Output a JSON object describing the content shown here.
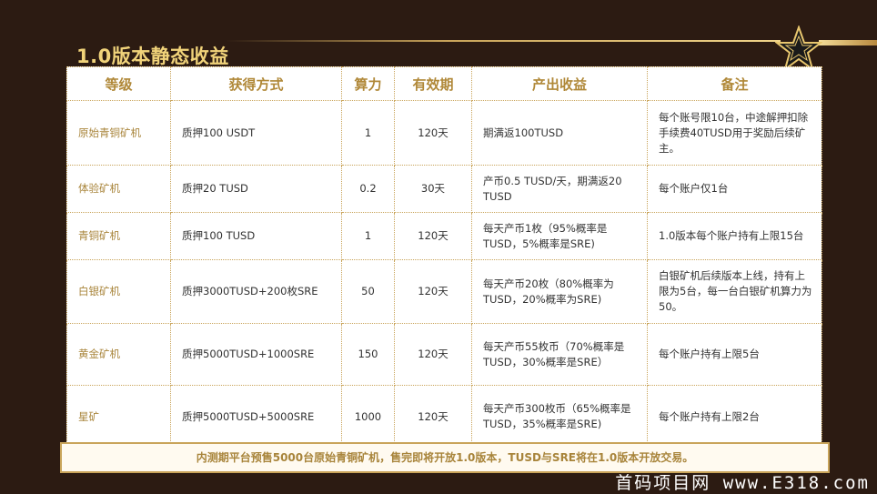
{
  "title": "1.0版本静态收益",
  "headers": [
    "等级",
    "获得方式",
    "算力",
    "有效期",
    "产出收益",
    "备注"
  ],
  "rows": [
    {
      "level": "原始青铜矿机",
      "method": "质押100 USDT",
      "power": "1",
      "period": "120天",
      "output": "期满返100TUSD",
      "note": "每个账号限10台，中途解押扣除手续费40TUSD用于奖励后续矿主。"
    },
    {
      "level": "体验矿机",
      "method": "质押20 TUSD",
      "power": "0.2",
      "period": "30天",
      "output": "产币0.5 TUSD/天，期满返20 TUSD",
      "note": "每个账户仅1台"
    },
    {
      "level": "青铜矿机",
      "method": "质押100 TUSD",
      "power": "1",
      "period": "120天",
      "output": "每天产币1枚（95%概率是TUSD，5%概率是SRE)",
      "note": "1.0版本每个账户持有上限15台"
    },
    {
      "level": "白银矿机",
      "method": "质押3000TUSD+200枚SRE",
      "power": "50",
      "period": "120天",
      "output": "每天产币20枚（80%概率为TUSD，20%概率为SRE)",
      "note": "白银矿机后续版本上线，持有上限为5台，每一台白银矿机算力为50。"
    },
    {
      "level": "黄金矿机",
      "method": "质押5000TUSD+1000SRE",
      "power": "150",
      "period": "120天",
      "output": "每天产币55枚币（70%概率是TUSD，30%概率是SRE）",
      "note": "每个账户持有上限5台"
    },
    {
      "level": "星矿",
      "method": "质押5000TUSD+5000SRE",
      "power": "1000",
      "period": "120天",
      "output": "每天产币300枚币（65%概率是TUSD，35%概率是SRE)",
      "note": "每个账户持有上限2台"
    }
  ],
  "footer": "内测期平台预售5000台原始青铜矿机，售完即将开放1.0版本，TUSD与SRE将在1.0版本开放交易。",
  "watermark": "首码项目网 www.E318.com",
  "colors": {
    "background": "#2c1b12",
    "gold": "#c9a45a",
    "title": "#f1d37a"
  }
}
